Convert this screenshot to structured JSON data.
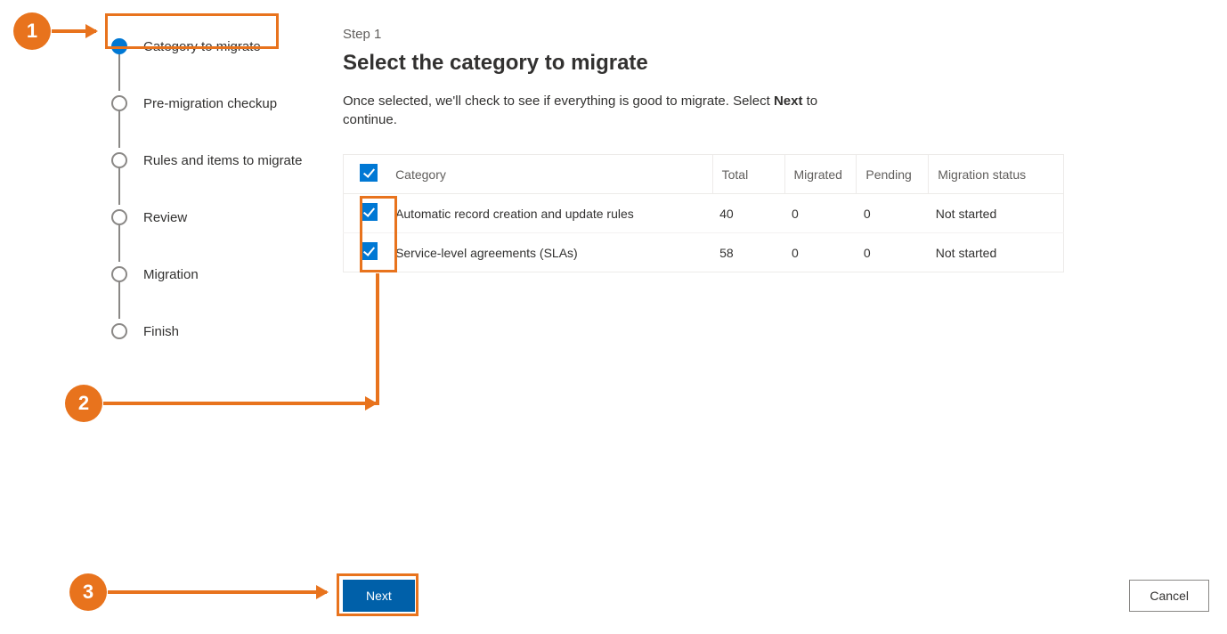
{
  "wizard": {
    "steps": [
      {
        "label": "Category to migrate",
        "active": true
      },
      {
        "label": "Pre-migration checkup",
        "active": false
      },
      {
        "label": "Rules and items to migrate",
        "active": false
      },
      {
        "label": "Review",
        "active": false
      },
      {
        "label": "Migration",
        "active": false
      },
      {
        "label": "Finish",
        "active": false
      }
    ]
  },
  "main": {
    "step_pre": "Step 1",
    "title": "Select the category to migrate",
    "desc_pre": "Once selected, we'll check to see if everything is good to migrate. Select ",
    "desc_bold": "Next",
    "desc_post": " to continue."
  },
  "table": {
    "headers": {
      "category": "Category",
      "total": "Total",
      "migrated": "Migrated",
      "pending": "Pending",
      "status": "Migration status"
    },
    "rows": [
      {
        "category": "Automatic record creation and update rules",
        "total": "40",
        "migrated": "0",
        "pending": "0",
        "status": "Not started",
        "checked": true
      },
      {
        "category": "Service-level agreements (SLAs)",
        "total": "58",
        "migrated": "0",
        "pending": "0",
        "status": "Not started",
        "checked": true
      }
    ]
  },
  "buttons": {
    "next": "Next",
    "cancel": "Cancel"
  },
  "annotations": {
    "one": "1",
    "two": "2",
    "three": "3"
  }
}
